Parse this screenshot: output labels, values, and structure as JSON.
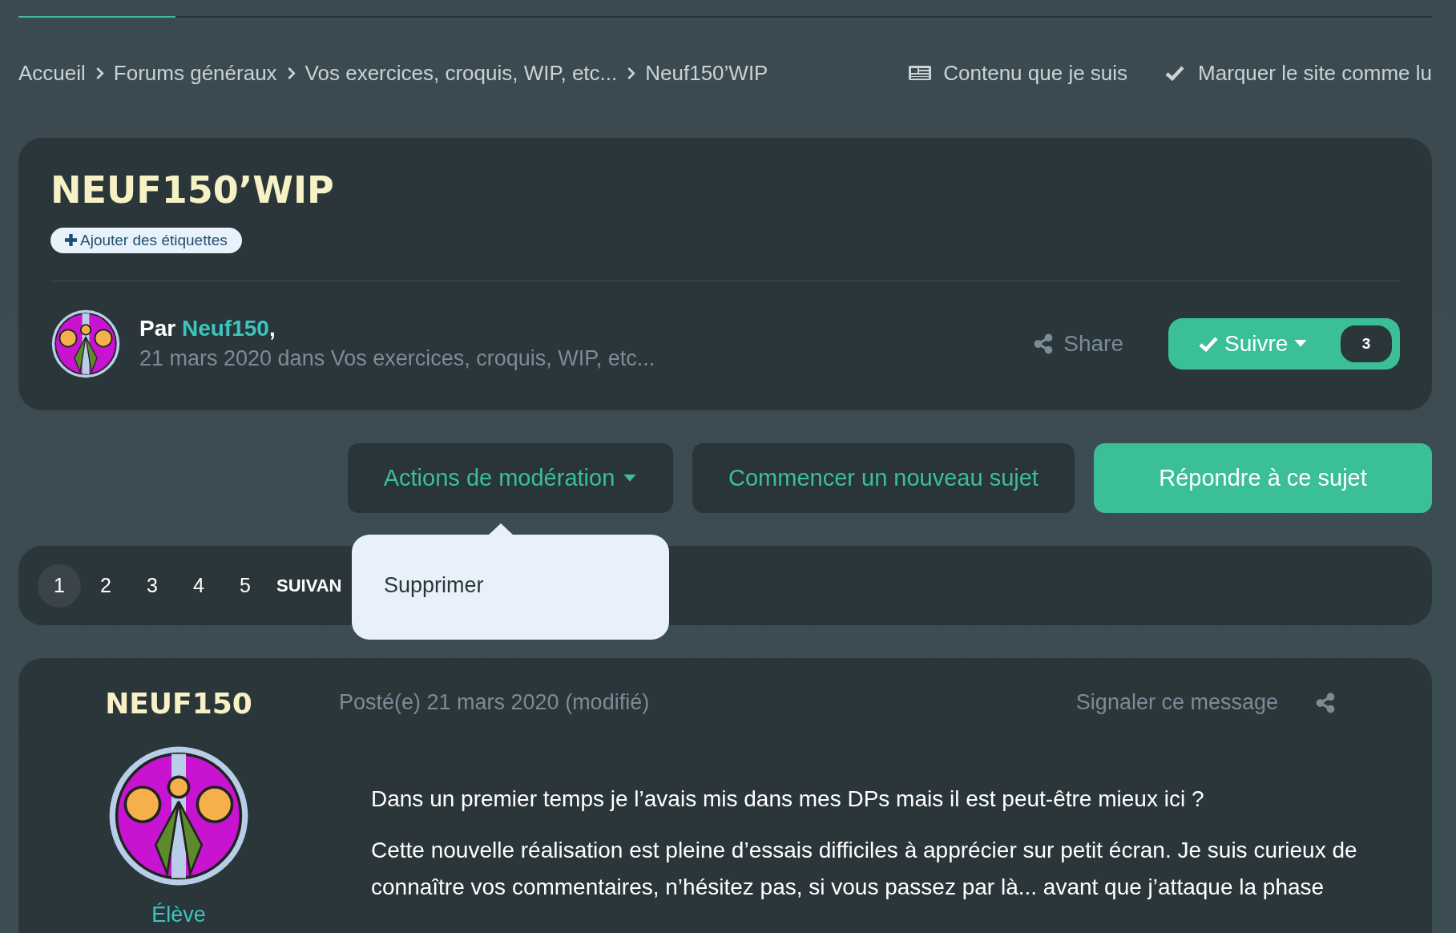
{
  "breadcrumb": [
    {
      "label": "Accueil"
    },
    {
      "label": "Forums généraux"
    },
    {
      "label": "Vos exercices, croquis, WIP, etc..."
    },
    {
      "label": "Neuf150’WIP"
    }
  ],
  "breadcrumb_actions": [
    {
      "kind": "followed",
      "label": "Contenu que je suis"
    },
    {
      "kind": "mark_read",
      "label": "Marquer le site comme lu"
    }
  ],
  "topic": {
    "title": "NEUF150’WIP",
    "tag_button": "Ajouter des étiquettes",
    "author_prefix": "Par",
    "author": "Neuf150",
    "author_suffix": ",",
    "meta": "21 mars 2020 dans Vos exercices, croquis, WIP, etc...",
    "share": "Share",
    "follow": {
      "label": "Suivre",
      "count": "3"
    }
  },
  "actions": [
    {
      "kind": "menu",
      "label": "Actions de modération",
      "expanded": true
    },
    {
      "kind": "secondary",
      "label": "Commencer un nouveau sujet"
    },
    {
      "kind": "primary",
      "label": "Répondre à ce sujet"
    }
  ],
  "dropdown": {
    "items": [
      "Supprimer"
    ]
  },
  "pagination": {
    "pages": [
      {
        "label": "1",
        "selected": true
      },
      {
        "label": "2",
        "selected": false
      },
      {
        "label": "3",
        "selected": false
      },
      {
        "label": "4",
        "selected": false
      },
      {
        "label": "5",
        "selected": false
      }
    ],
    "next": "SUIVAN"
  },
  "post": {
    "author": "NEUF150",
    "rank": "Élève",
    "meta": "Posté(e) 21 mars 2020 (modifié)",
    "report": "Signaler ce message",
    "paragraphs": [
      "Dans un premier temps je l’avais mis dans mes DPs mais il est peut-être mieux ici ?",
      "Cette nouvelle réalisation est pleine d’essais difficiles à apprécier sur petit écran. Je suis curieux de connaître vos commentaires, n’hésitez pas, si vous passez par là... avant que j’attaque la phase"
    ]
  }
}
